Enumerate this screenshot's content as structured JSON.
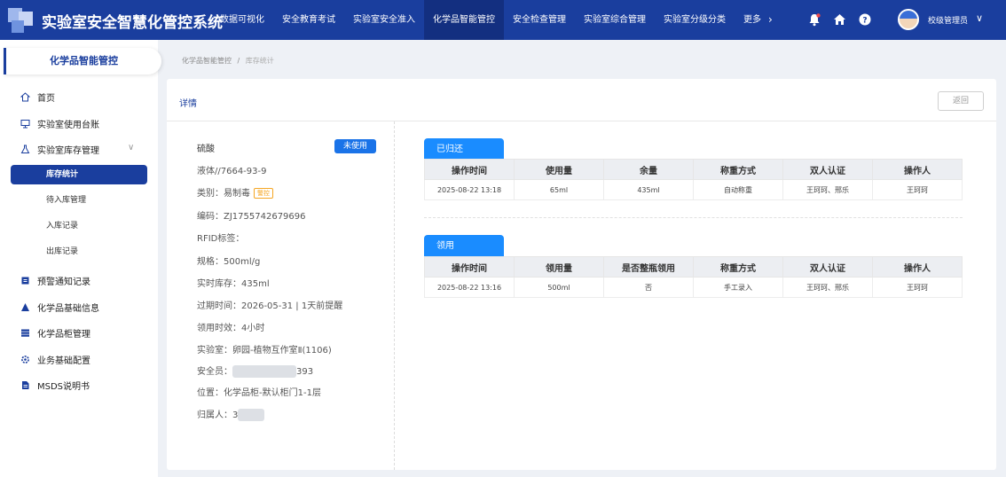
{
  "app": {
    "title": "实验室安全智慧化管控系统"
  },
  "nav": {
    "items": [
      "数据可视化",
      "安全教育考试",
      "实验室安全准入",
      "化学品智能管控",
      "安全检查管理",
      "实验室综合管理",
      "实验室分级分类"
    ],
    "active_index": 3,
    "more_label": "更多"
  },
  "user": {
    "name": "校级管理员"
  },
  "sidebar": {
    "module_title": "化学品智能管控",
    "items": [
      {
        "label": "首页",
        "icon": "home-icon"
      },
      {
        "label": "实验室使用台账",
        "icon": "monitor-icon"
      },
      {
        "label": "实验室库存管理",
        "icon": "flask-icon"
      },
      {
        "label": "预警通知记录",
        "icon": "alert-icon"
      },
      {
        "label": "化学品基础信息",
        "icon": "triangle-icon"
      },
      {
        "label": "化学品柜管理",
        "icon": "list-icon"
      },
      {
        "label": "业务基础配置",
        "icon": "gear-icon"
      },
      {
        "label": "MSDS说明书",
        "icon": "document-icon"
      }
    ],
    "sub_items": [
      "库存统计",
      "待入库管理",
      "入库记录",
      "出库记录"
    ],
    "active_sub_index": 0
  },
  "breadcrumb": {
    "parent": "化学品智能管控",
    "separator": "/",
    "current": "库存统计"
  },
  "card": {
    "title": "详情",
    "back_label": "返回"
  },
  "detail": {
    "name": "硫酸",
    "status": "未使用",
    "cas": "液体//7664-93-9",
    "category": "类别：易制毒",
    "category_tag": "警控",
    "code": "编码：ZJ1755742679696",
    "rfid": "RFID标签：",
    "spec": "规格：500ml/g",
    "stock": "实时库存：435ml",
    "expiry": "过期时间：2026-05-31 | 1天前提醒",
    "period": "领用时效：4小时",
    "lab": "实验室：卵园-植物互作室Ⅱ(1106)",
    "safety_prefix": "安全员：",
    "safety_suffix": "393",
    "location": "位置：化学品柜-默认柜门1-1层",
    "owner_prefix": "归属人：",
    "owner_initial": "3"
  },
  "returned": {
    "tab_label": "已归还",
    "columns": [
      "操作时间",
      "使用量",
      "余量",
      "称重方式",
      "双人认证",
      "操作人"
    ],
    "rows": [
      [
        "2025-08-22 13:18",
        "65ml",
        "435ml",
        "自动称重",
        "王珂珂、邢乐",
        "王珂珂"
      ]
    ]
  },
  "received": {
    "tab_label": "领用",
    "columns": [
      "操作时间",
      "领用量",
      "是否整瓶领用",
      "称重方式",
      "双人认证",
      "操作人"
    ],
    "rows": [
      [
        "2025-08-22 13:16",
        "500ml",
        "否",
        "手工录入",
        "王珂珂、邢乐",
        "王珂珂"
      ]
    ]
  },
  "colors": {
    "primary": "#1a3e9e",
    "tab_blue": "#1a8cff",
    "status_blue": "#1a73e8",
    "warn": "#f5a623"
  }
}
